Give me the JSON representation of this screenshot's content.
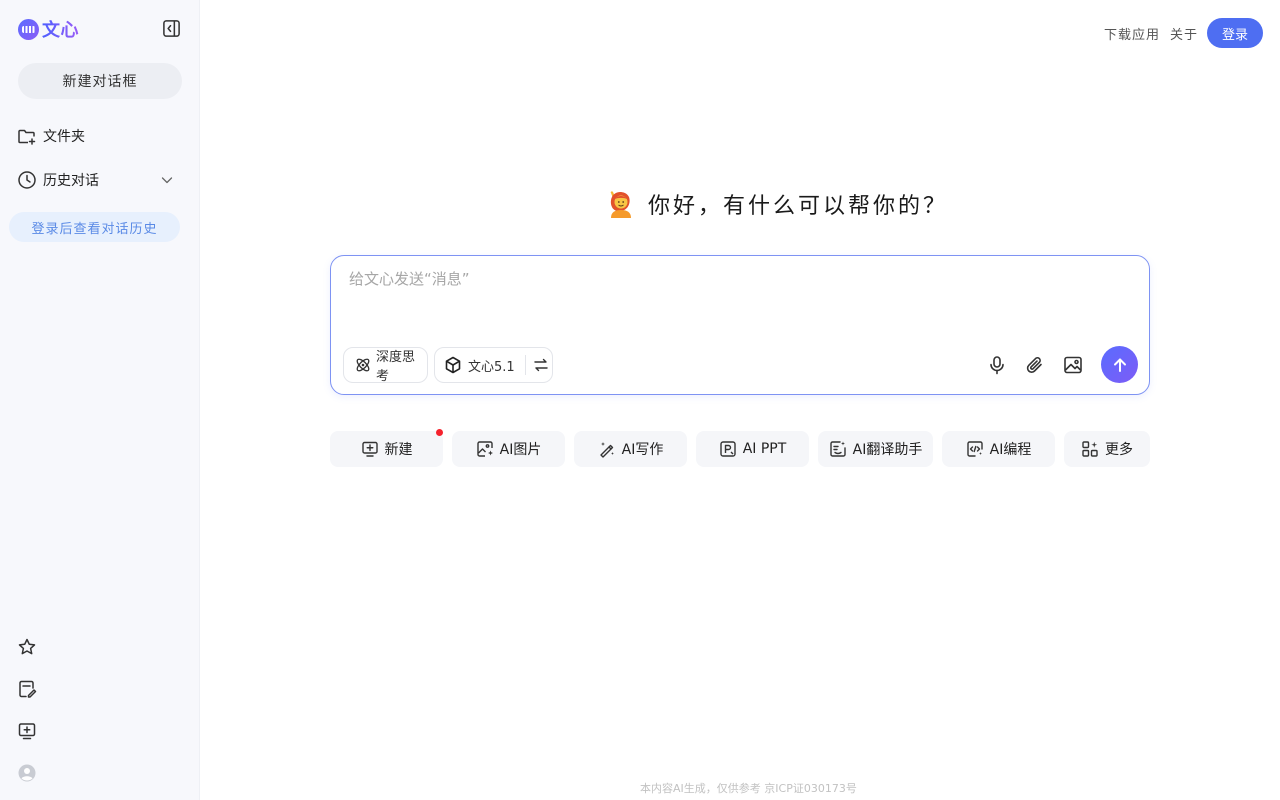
{
  "app": {
    "logo_text": "文心"
  },
  "sidebar": {
    "new_chat_label": "新建对话框",
    "items": [
      {
        "label": "文件夹"
      },
      {
        "label": "历史对话"
      }
    ],
    "login_tip": "登录后查看对话历史",
    "bottom_icons": [
      "star-icon",
      "note-edit-icon",
      "screen-plus-icon",
      "user-avatar-icon"
    ]
  },
  "header": {
    "download_label": "下载应用",
    "about_label": "关于",
    "login_label": "登录"
  },
  "main": {
    "greeting": "你好，有什么可以帮你的？",
    "input_placeholder": "给文心发送“消息”",
    "deep_think_label": "深度思考",
    "model_label": "文心5.1",
    "accent_color": "#4e6ef2",
    "quick_actions": [
      {
        "label": "新建"
      },
      {
        "label": "AI图片"
      },
      {
        "label": "AI写作"
      },
      {
        "label": "AI PPT"
      },
      {
        "label": "AI翻译助手"
      },
      {
        "label": "AI编程"
      },
      {
        "label": "更多"
      }
    ]
  },
  "footer": {
    "text": "本内容AI生成，仅供参考  京ICP证030173号"
  }
}
